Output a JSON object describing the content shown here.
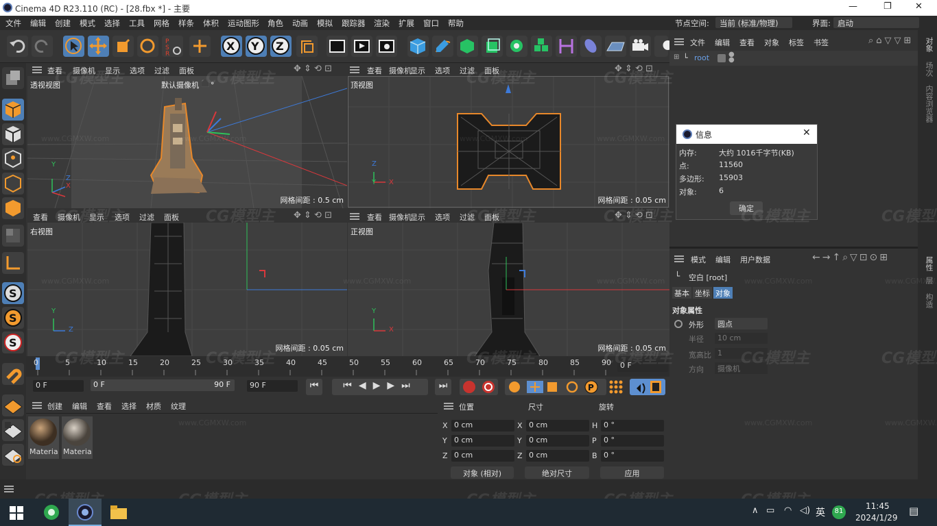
{
  "title": {
    "text": "Cinema 4D R23.110 (RC) - [28.fbx *] - 主要",
    "minimize": "—",
    "maximize": "❐",
    "close": "✕"
  },
  "menu": {
    "items": [
      "文件",
      "编辑",
      "创建",
      "模式",
      "选择",
      "工具",
      "网格",
      "样条",
      "体积",
      "运动图形",
      "角色",
      "动画",
      "模拟",
      "跟踪器",
      "渲染",
      "扩展",
      "窗口",
      "帮助"
    ],
    "node_space_label": "节点空间:",
    "node_space_value": "当前 (标准/物理)",
    "layout_label": "界面:",
    "layout_value": "启动"
  },
  "viewport_menu": [
    "查看",
    "摄像机",
    "显示",
    "选项",
    "过滤",
    "面板"
  ],
  "viewports": {
    "perspective": {
      "label": "透视视图",
      "camera": "默认摄像机",
      "grid": "网格间距 : 0.5 cm"
    },
    "top": {
      "label": "顶视图",
      "grid": "网格间距 : 0.05 cm"
    },
    "right": {
      "label": "右视图",
      "grid": "网格间距 : 0.05 cm"
    },
    "front": {
      "label": "正视图",
      "grid": "网格间距 : 0.05 cm"
    }
  },
  "axes": {
    "x": "X",
    "y": "Y",
    "z": "Z"
  },
  "watermark": {
    "logo": "CG模型主",
    "url": "www.CGMXW.com"
  },
  "timeline": {
    "ticks": [
      "0",
      "5",
      "10",
      "15",
      "20",
      "25",
      "30",
      "35",
      "40",
      "45",
      "50",
      "55",
      "60",
      "65",
      "70",
      "75",
      "80",
      "85",
      "90"
    ],
    "end_frame": "0 F"
  },
  "timectrl": {
    "start": "0 F",
    "slider_start": "0 F",
    "slider_end": "90 F",
    "end": "90 F"
  },
  "materials": {
    "menu": [
      "创建",
      "编辑",
      "查看",
      "选择",
      "材质",
      "纹理"
    ],
    "items": [
      "Materia",
      "Materia"
    ]
  },
  "coords": {
    "headers": [
      "位置",
      "尺寸",
      "旋转"
    ],
    "rows": [
      {
        "a": "X",
        "v1": "0 cm",
        "b": "X",
        "v2": "0 cm",
        "c": "H",
        "v3": "0 °"
      },
      {
        "a": "Y",
        "v1": "0 cm",
        "b": "Y",
        "v2": "0 cm",
        "c": "P",
        "v3": "0 °"
      },
      {
        "a": "Z",
        "v1": "0 cm",
        "b": "Z",
        "v2": "0 cm",
        "c": "B",
        "v3": "0 °"
      }
    ],
    "mode": "对象 (相对)",
    "size_mode": "绝对尺寸",
    "apply": "应用"
  },
  "objects": {
    "menu": [
      "文件",
      "编辑",
      "查看",
      "对象",
      "标签",
      "书签"
    ],
    "root": "root"
  },
  "info_dialog": {
    "title": "信息",
    "rows": [
      {
        "k": "内存:",
        "v": "大约 1016千字节(KB)"
      },
      {
        "k": "点:",
        "v": "11560"
      },
      {
        "k": "多边形:",
        "v": "15903"
      },
      {
        "k": "对象:",
        "v": "6"
      }
    ],
    "ok": "确定"
  },
  "attributes": {
    "menu": [
      "模式",
      "编辑",
      "用户数据"
    ],
    "object": "空白 [root]",
    "tabs": [
      "基本",
      "坐标",
      "对象"
    ],
    "section": "对象属性",
    "props": [
      {
        "k": "外形",
        "v": "圆点"
      },
      {
        "k": "半径",
        "v": "10 cm"
      },
      {
        "k": "宽高比",
        "v": "1"
      },
      {
        "k": "方向",
        "v": "摄像机"
      }
    ]
  },
  "right_strip": [
    "对象",
    "场次",
    "内容浏览器",
    "属性",
    "层",
    "构造"
  ],
  "taskbar": {
    "time": "11:45",
    "date": "2024/1/29",
    "ime": "英",
    "badge": "81"
  }
}
